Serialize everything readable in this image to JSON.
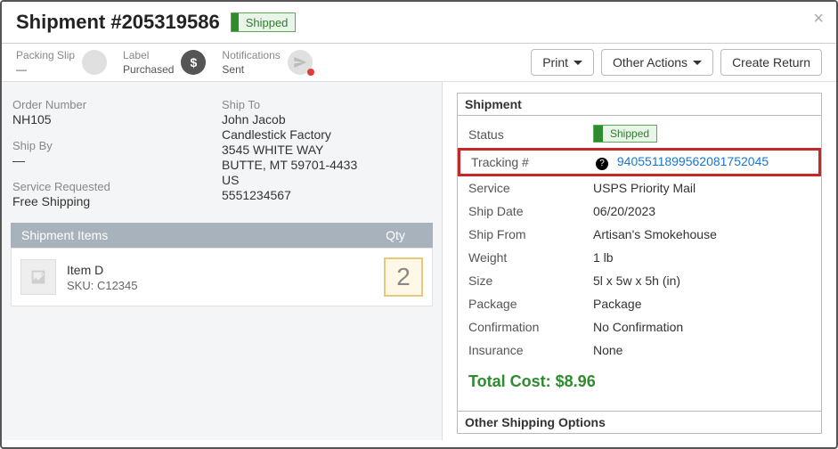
{
  "header": {
    "title": "Shipment #205319586",
    "badge": "Shipped"
  },
  "progress": {
    "packing": {
      "label": "Packing Slip",
      "value": "—"
    },
    "label": {
      "label": "Label",
      "value": "Purchased"
    },
    "notifications": {
      "label": "Notifications",
      "value": "Sent"
    }
  },
  "actions": {
    "print": "Print",
    "other": "Other Actions",
    "return": "Create Return"
  },
  "left": {
    "order_number_label": "Order Number",
    "order_number": "NH105",
    "ship_by_label": "Ship By",
    "ship_by": "—",
    "service_requested_label": "Service Requested",
    "service_requested": "Free Shipping",
    "ship_to_label": "Ship To",
    "ship_to": [
      "John Jacob",
      "Candlestick Factory",
      "3545 WHITE WAY",
      "BUTTE, MT 59701-4433",
      "US",
      "5551234567"
    ],
    "items_header": {
      "title": "Shipment Items",
      "qty": "Qty"
    },
    "item": {
      "name": "Item D",
      "sku": "SKU: C12345",
      "qty": "2"
    }
  },
  "shipment": {
    "panel_title": "Shipment",
    "rows": {
      "status": {
        "label": "Status",
        "badge": "Shipped"
      },
      "tracking": {
        "label": "Tracking #",
        "value": "9405511899562081752045"
      },
      "service": {
        "label": "Service",
        "value": "USPS Priority Mail"
      },
      "ship_date": {
        "label": "Ship Date",
        "value": "06/20/2023"
      },
      "ship_from": {
        "label": "Ship From",
        "value": "Artisan's Smokehouse"
      },
      "weight": {
        "label": "Weight",
        "value": "1 lb"
      },
      "size": {
        "label": "Size",
        "value": "5l x 5w x 5h (in)"
      },
      "package": {
        "label": "Package",
        "value": "Package"
      },
      "confirmation": {
        "label": "Confirmation",
        "value": "No Confirmation"
      },
      "insurance": {
        "label": "Insurance",
        "value": "None"
      }
    },
    "total": "Total Cost: $8.96",
    "other_options": "Other Shipping Options"
  }
}
